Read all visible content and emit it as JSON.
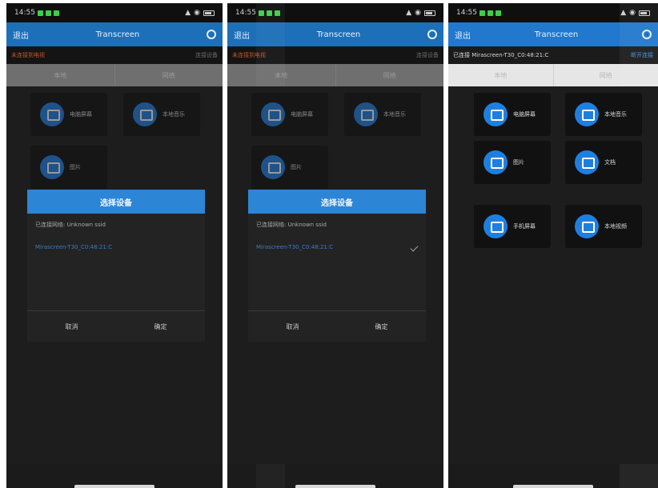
{
  "status": {
    "time": "14:55"
  },
  "app": {
    "title": "Transcreen",
    "back_label": "退出"
  },
  "device_bar": {
    "disconnected_label": "未连接到电视",
    "disconnected_action": "连接设备",
    "connected_label": "已连接 Mirascreen-T30_C0:48:21:C",
    "connected_action": "断开连接"
  },
  "tabs": [
    {
      "label": "本地"
    },
    {
      "label": "网络"
    }
  ],
  "tiles": [
    {
      "label": "电脑屏幕",
      "icon": "monitor-icon"
    },
    {
      "label": "本地音乐",
      "icon": "music-icon"
    },
    {
      "label": "图片",
      "icon": "image-icon"
    },
    {
      "label": "文档",
      "icon": "document-icon"
    },
    {
      "label": "手机屏幕",
      "icon": "phone-screen-icon"
    },
    {
      "label": "本地视频",
      "icon": "video-icon"
    }
  ],
  "dialog": {
    "title": "选择设备",
    "wifi_line": "已连接网络: Unknown ssid",
    "device": "Mirascreen-T30_C0:48:21:C",
    "cancel": "取消",
    "confirm": "确定"
  },
  "colors": {
    "accent": "#2d85d6",
    "warning": "#c2552c",
    "background": "#1d1d1d"
  }
}
